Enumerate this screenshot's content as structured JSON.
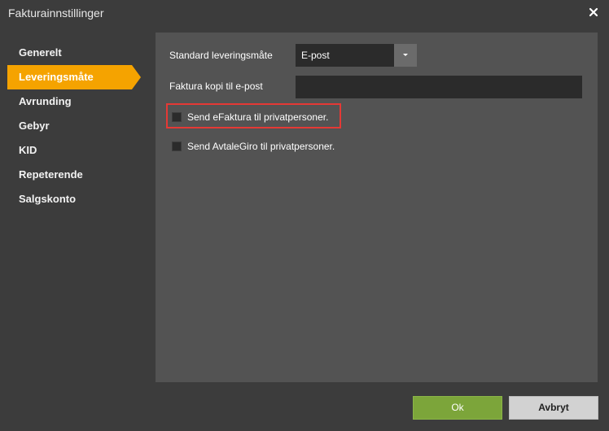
{
  "dialog": {
    "title": "Fakturainnstillinger"
  },
  "sidebar": {
    "items": [
      {
        "label": "Generelt",
        "active": false
      },
      {
        "label": "Leveringsmåte",
        "active": true
      },
      {
        "label": "Avrunding",
        "active": false
      },
      {
        "label": "Gebyr",
        "active": false
      },
      {
        "label": "KID",
        "active": false
      },
      {
        "label": "Repeterende",
        "active": false
      },
      {
        "label": "Salgskonto",
        "active": false
      }
    ]
  },
  "form": {
    "delivery_label": "Standard leveringsmåte",
    "delivery_value": "E-post",
    "copy_label": "Faktura kopi til e-post",
    "copy_value": "",
    "efaktura_label": "Send eFaktura til privatpersoner.",
    "efaktura_checked": false,
    "avtalegiro_label": "Send AvtaleGiro til privatpersoner.",
    "avtalegiro_checked": false
  },
  "footer": {
    "ok_label": "Ok",
    "cancel_label": "Avbryt"
  },
  "colors": {
    "accent": "#f5a300",
    "ok": "#7ca53a",
    "highlight": "#e53935",
    "background": "#3c3c3c",
    "panel": "#535353"
  },
  "icons": {
    "close": "close-icon",
    "dropdown": "chevron-down-icon"
  }
}
